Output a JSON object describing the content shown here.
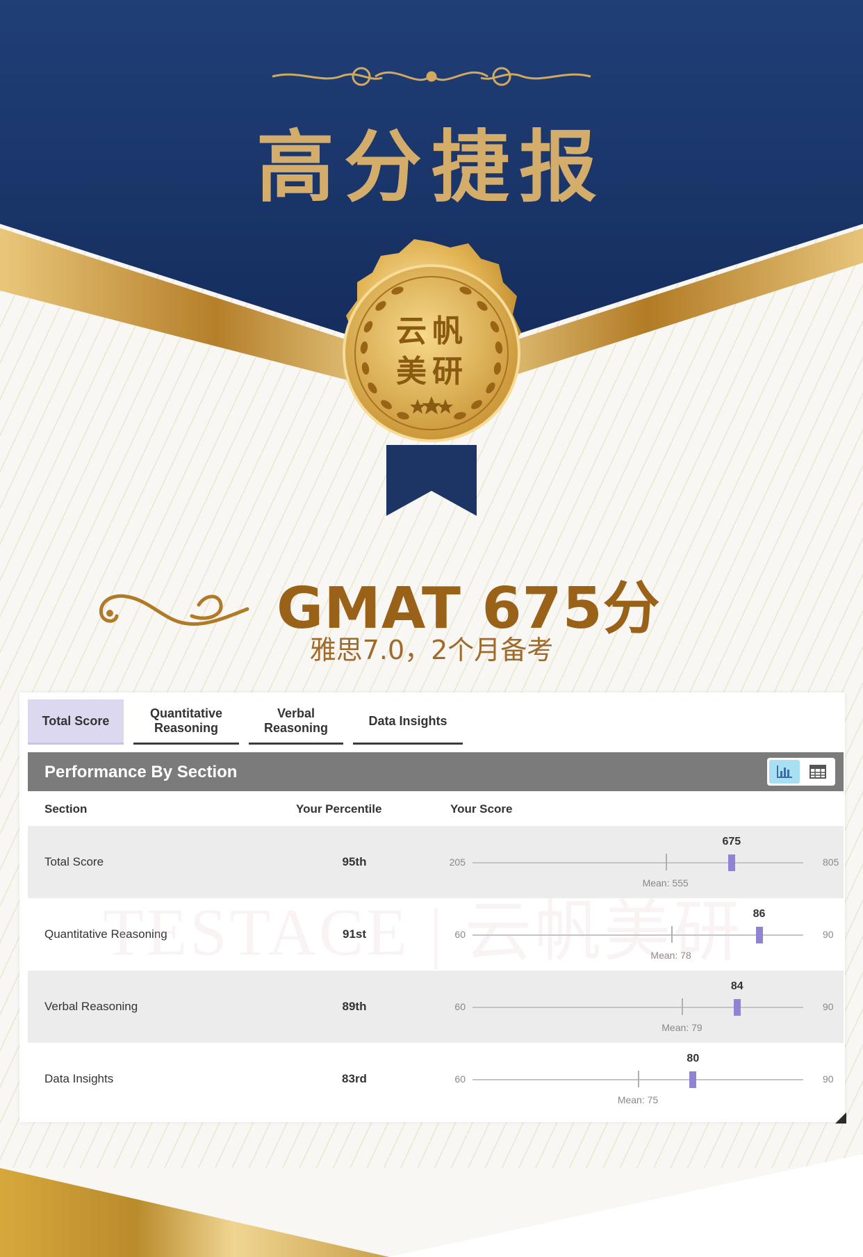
{
  "poster": {
    "headline": "高分捷报",
    "seal_line1": "云帆",
    "seal_line2": "美研",
    "score_title": "GMAT 675分",
    "score_subtitle": "雅思7.0，2个月备考",
    "watermark": "TESTACE | 云帆美研",
    "colors": {
      "navy": "#1b3566",
      "gold": "#c8963a",
      "text_brown": "#9a6218"
    }
  },
  "report": {
    "tabs": [
      {
        "label": "Total Score",
        "active": true
      },
      {
        "label": "Quantitative Reasoning",
        "active": false
      },
      {
        "label": "Verbal Reasoning",
        "active": false
      },
      {
        "label": "Data Insights",
        "active": false
      }
    ],
    "section_title": "Performance By Section",
    "view_toggle": {
      "chart_icon": "bar-chart-icon",
      "table_icon": "table-grid-icon",
      "selected": "chart"
    },
    "columns": {
      "section": "Section",
      "percentile": "Your Percentile",
      "score": "Your Score"
    },
    "rows": [
      {
        "section": "Total Score",
        "percentile": "95th",
        "min": 205,
        "max": 805,
        "score": 675,
        "mean": 555,
        "mean_label": "Mean: 555"
      },
      {
        "section": "Quantitative Reasoning",
        "percentile": "91st",
        "min": 60,
        "max": 90,
        "score": 86,
        "mean": 78,
        "mean_label": "Mean: 78"
      },
      {
        "section": "Verbal Reasoning",
        "percentile": "89th",
        "min": 60,
        "max": 90,
        "score": 84,
        "mean": 79,
        "mean_label": "Mean: 79"
      },
      {
        "section": "Data Insights",
        "percentile": "83rd",
        "min": 60,
        "max": 90,
        "score": 80,
        "mean": 75,
        "mean_label": "Mean: 75"
      }
    ]
  }
}
